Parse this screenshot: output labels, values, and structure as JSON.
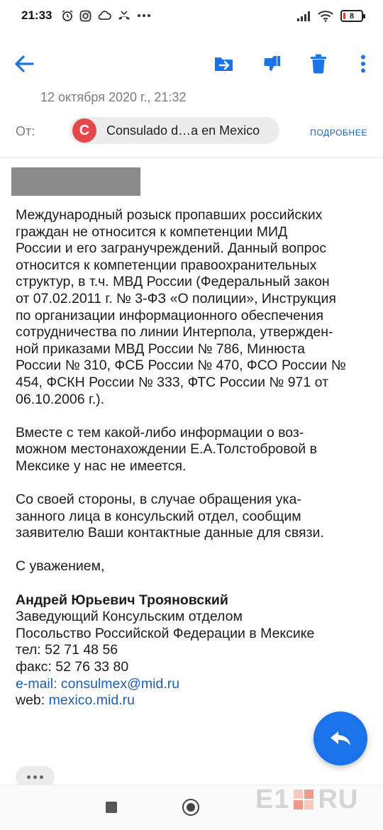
{
  "status_bar": {
    "time": "21:33",
    "battery": "8",
    "icons_left": [
      "alarm-icon",
      "instagram-icon",
      "cloud-icon",
      "missed-call-icon",
      "more-dots-icon"
    ],
    "icons_right": [
      "signal-icon",
      "wifi-icon",
      "battery-icon"
    ]
  },
  "toolbar": {
    "icons": [
      "back-arrow-icon",
      "move-to-icon",
      "spam-icon",
      "delete-icon",
      "overflow-menu-icon"
    ]
  },
  "message": {
    "date": "12 октября 2020 г., 21:32",
    "from_label": "От:",
    "sender_initial": "C",
    "sender_name": "Consulado d…a en Mexico",
    "details_label": "ПОДРОБНЕЕ",
    "body": {
      "p1": "Международный розыск пропавших российских\nграждан не относится к компетенции МИД\nРоссии и его загранучреждений. Данный вопрос\nотносится к компетенции правоохранительных\nструктур, в т.ч. МВД России (Федеральный закон\nот 07.02.2011 г. № 3-ФЗ «О полиции», Инструкция\nпо организации информационного обеспечения\nсотрудничества по линии Интерпола, утвержден-\nной приказами МВД России № 786, Минюста\nРоссии № 310, ФСБ России № 470, ФСО России №\n454, ФСКН России № 333, ФТС России № 971 от\n06.10.2006 г.).",
      "p2": "Вместе с тем какой-либо информации о воз-\nможном местонахождении Е.А.Толстобровой в\nМексике у нас не имеется.",
      "p3": "Со своей стороны, в случае обращения ука-\nзанного лица в консульский отдел, сообщим\nзаявителю Ваши контактные данные для связи.",
      "closing": "С уважением,"
    },
    "signature": {
      "name": "Андрей Юрьевич Трояновский",
      "title": "Заведующий Консульским отделом",
      "org": "Посольство Российской Федерации в Мексике",
      "phone": "тел: 52 71 48 56",
      "fax": "факс: 52 76 33 80",
      "email_label": "e-mail: consulmex@mid.ru",
      "web_label": "web: ",
      "web_link": "mexico.mid.ru"
    }
  },
  "watermark": {
    "text_left": "E1",
    "text_right": "RU"
  },
  "colors": {
    "accent": "#1a73e8",
    "link": "#1a5fb4",
    "avatar": "#e5474b"
  }
}
